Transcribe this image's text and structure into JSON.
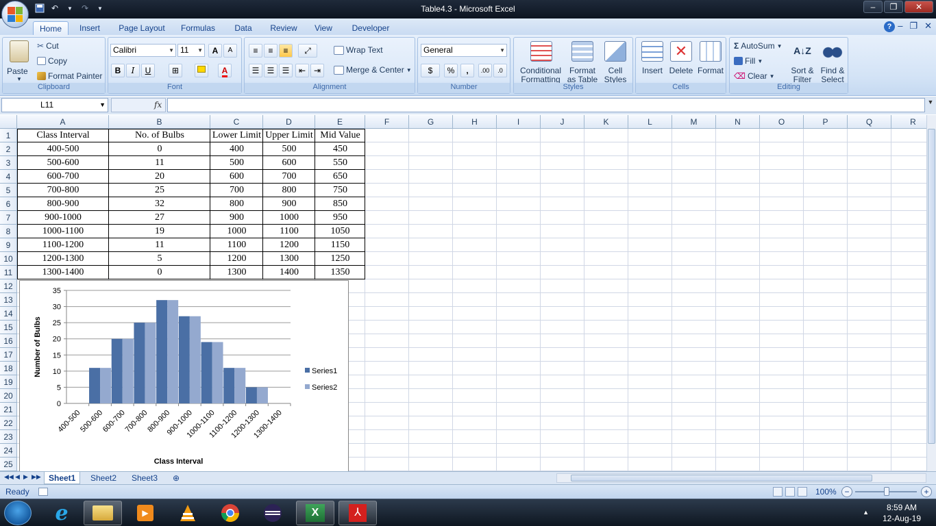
{
  "window": {
    "title": "Table4.3  -  Microsoft Excel"
  },
  "ribbon_tabs": [
    "Home",
    "Insert",
    "Page Layout",
    "Formulas",
    "Data",
    "Review",
    "View",
    "Developer"
  ],
  "clipboard": {
    "paste": "Paste",
    "cut": "Cut",
    "copy": "Copy",
    "format_painter": "Format Painter",
    "label": "Clipboard"
  },
  "font": {
    "name": "Calibri",
    "size": "11",
    "bold": "B",
    "italic": "I",
    "underline": "U",
    "grow": "A",
    "shrink": "A",
    "label": "Font"
  },
  "alignment": {
    "wrap_text": "Wrap Text",
    "merge_center": "Merge & Center",
    "label": "Alignment"
  },
  "number": {
    "format": "General",
    "currency": "$",
    "percent": "%",
    "comma": ",",
    "inc_dec": ".00",
    "dec_dec": ".0",
    "label": "Number"
  },
  "styles": {
    "conditional": "Conditional",
    "conditional2": "Formatting",
    "format_table": "Format",
    "format_table2": "as Table",
    "cell_styles": "Cell",
    "cell_styles2": "Styles",
    "label": "Styles"
  },
  "cells": {
    "insert": "Insert",
    "delete": "Delete",
    "format": "Format",
    "label": "Cells"
  },
  "editing": {
    "autosum": "AutoSum",
    "fill": "Fill",
    "clear": "Clear",
    "sort": "Sort &",
    "sort2": "Filter",
    "find": "Find &",
    "find2": "Select",
    "label": "Editing"
  },
  "formula_bar": {
    "name_box": "L11",
    "fx": "fx",
    "content": ""
  },
  "columns": [
    "A",
    "B",
    "C",
    "D",
    "E",
    "F",
    "G",
    "H",
    "I",
    "J",
    "K",
    "L",
    "M",
    "N",
    "O",
    "P",
    "Q",
    "R"
  ],
  "rows": [
    "1",
    "2",
    "3",
    "4",
    "5",
    "6",
    "7",
    "8",
    "9",
    "10",
    "11",
    "12",
    "13",
    "14",
    "15",
    "16",
    "17",
    "18",
    "19",
    "20",
    "21",
    "22",
    "23",
    "24",
    "25"
  ],
  "table": {
    "headers": [
      "Class Interval",
      "No. of Bulbs",
      "Lower Limit",
      "Upper Limit",
      "Mid Value"
    ],
    "rows": [
      [
        "400-500",
        "0",
        "400",
        "500",
        "450"
      ],
      [
        "500-600",
        "11",
        "500",
        "600",
        "550"
      ],
      [
        "600-700",
        "20",
        "600",
        "700",
        "650"
      ],
      [
        "700-800",
        "25",
        "700",
        "800",
        "750"
      ],
      [
        "800-900",
        "32",
        "800",
        "900",
        "850"
      ],
      [
        "900-1000",
        "27",
        "900",
        "1000",
        "950"
      ],
      [
        "1000-1100",
        "19",
        "1000",
        "1100",
        "1050"
      ],
      [
        "1100-1200",
        "11",
        "1100",
        "1200",
        "1150"
      ],
      [
        "1200-1300",
        "5",
        "1200",
        "1300",
        "1250"
      ],
      [
        "1300-1400",
        "0",
        "1300",
        "1400",
        "1350"
      ]
    ]
  },
  "chart_data": {
    "type": "bar",
    "categories": [
      "400-500",
      "500-600",
      "600-700",
      "700-800",
      "800-900",
      "900-1000",
      "1000-1100",
      "1100-1200",
      "1200-1300",
      "1300-1400"
    ],
    "series": [
      {
        "name": "Series1",
        "values": [
          0,
          11,
          20,
          25,
          32,
          27,
          19,
          11,
          5,
          0
        ],
        "color": "#4a6fa5"
      },
      {
        "name": "Series2",
        "values": [
          0,
          11,
          20,
          25,
          32,
          27,
          19,
          11,
          5,
          0
        ],
        "color": "#94a9cf"
      }
    ],
    "xlabel": "Class Interval",
    "ylabel": "Number of Bulbs",
    "ylim": [
      0,
      35
    ],
    "yticks": [
      "0",
      "5",
      "10",
      "15",
      "20",
      "25",
      "30",
      "35"
    ],
    "grid": true,
    "legend": "right"
  },
  "sheets": [
    "Sheet1",
    "Sheet2",
    "Sheet3"
  ],
  "status": {
    "ready": "Ready",
    "zoom": "100%",
    "zoom_minus": "−",
    "zoom_plus": "+"
  },
  "taskbar": {
    "time": "8:59 AM",
    "date": "12-Aug-19"
  }
}
